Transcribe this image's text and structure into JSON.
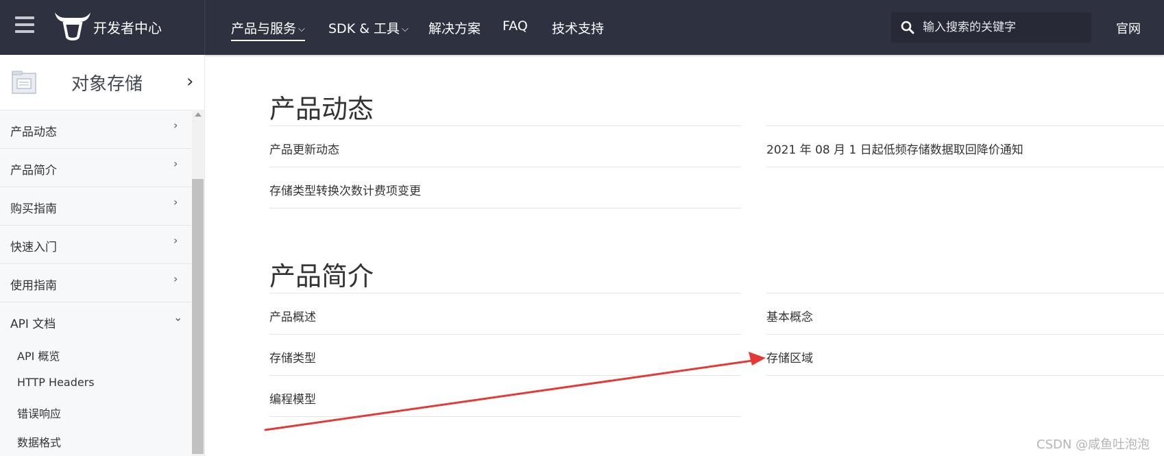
{
  "header": {
    "brand": "开发者中心",
    "nav": [
      {
        "label": "产品与服务",
        "chevron": "⌵"
      },
      {
        "label": "SDK & 工具",
        "chevron": "⌵"
      },
      {
        "label": "解决方案"
      },
      {
        "label": "FAQ"
      },
      {
        "label": "技术支持"
      }
    ],
    "search_placeholder": "输入搜索的关键字",
    "official": "官网"
  },
  "sidebar": {
    "title": "对象存储",
    "items": [
      {
        "label": "产品动态",
        "arrow": "›"
      },
      {
        "label": "产品简介",
        "arrow": "›"
      },
      {
        "label": "购买指南",
        "arrow": "›"
      },
      {
        "label": "快速入门",
        "arrow": "›"
      },
      {
        "label": "使用指南",
        "arrow": "›"
      },
      {
        "label": "API 文档",
        "arrow": "⌄"
      }
    ],
    "subitems": [
      "API 概览",
      "HTTP Headers",
      "错误响应",
      "数据格式"
    ]
  },
  "main": {
    "sections": [
      {
        "title": "产品动态",
        "left": [
          "产品更新动态",
          "存储类型转换次数计费项变更"
        ],
        "right": [
          "2021 年 08 月 1 日起低频存储数据取回降价通知"
        ]
      },
      {
        "title": "产品简介",
        "left": [
          "产品概述",
          "存储类型",
          "编程模型"
        ],
        "right": [
          "基本概念",
          "存储区域"
        ]
      }
    ]
  },
  "annotation": {
    "arrow_color": "#e53935"
  },
  "watermark": "CSDN @咸鱼吐泡泡",
  "colors": {
    "topbar": "#2e3240",
    "sidebar": "#f7f8fa"
  }
}
